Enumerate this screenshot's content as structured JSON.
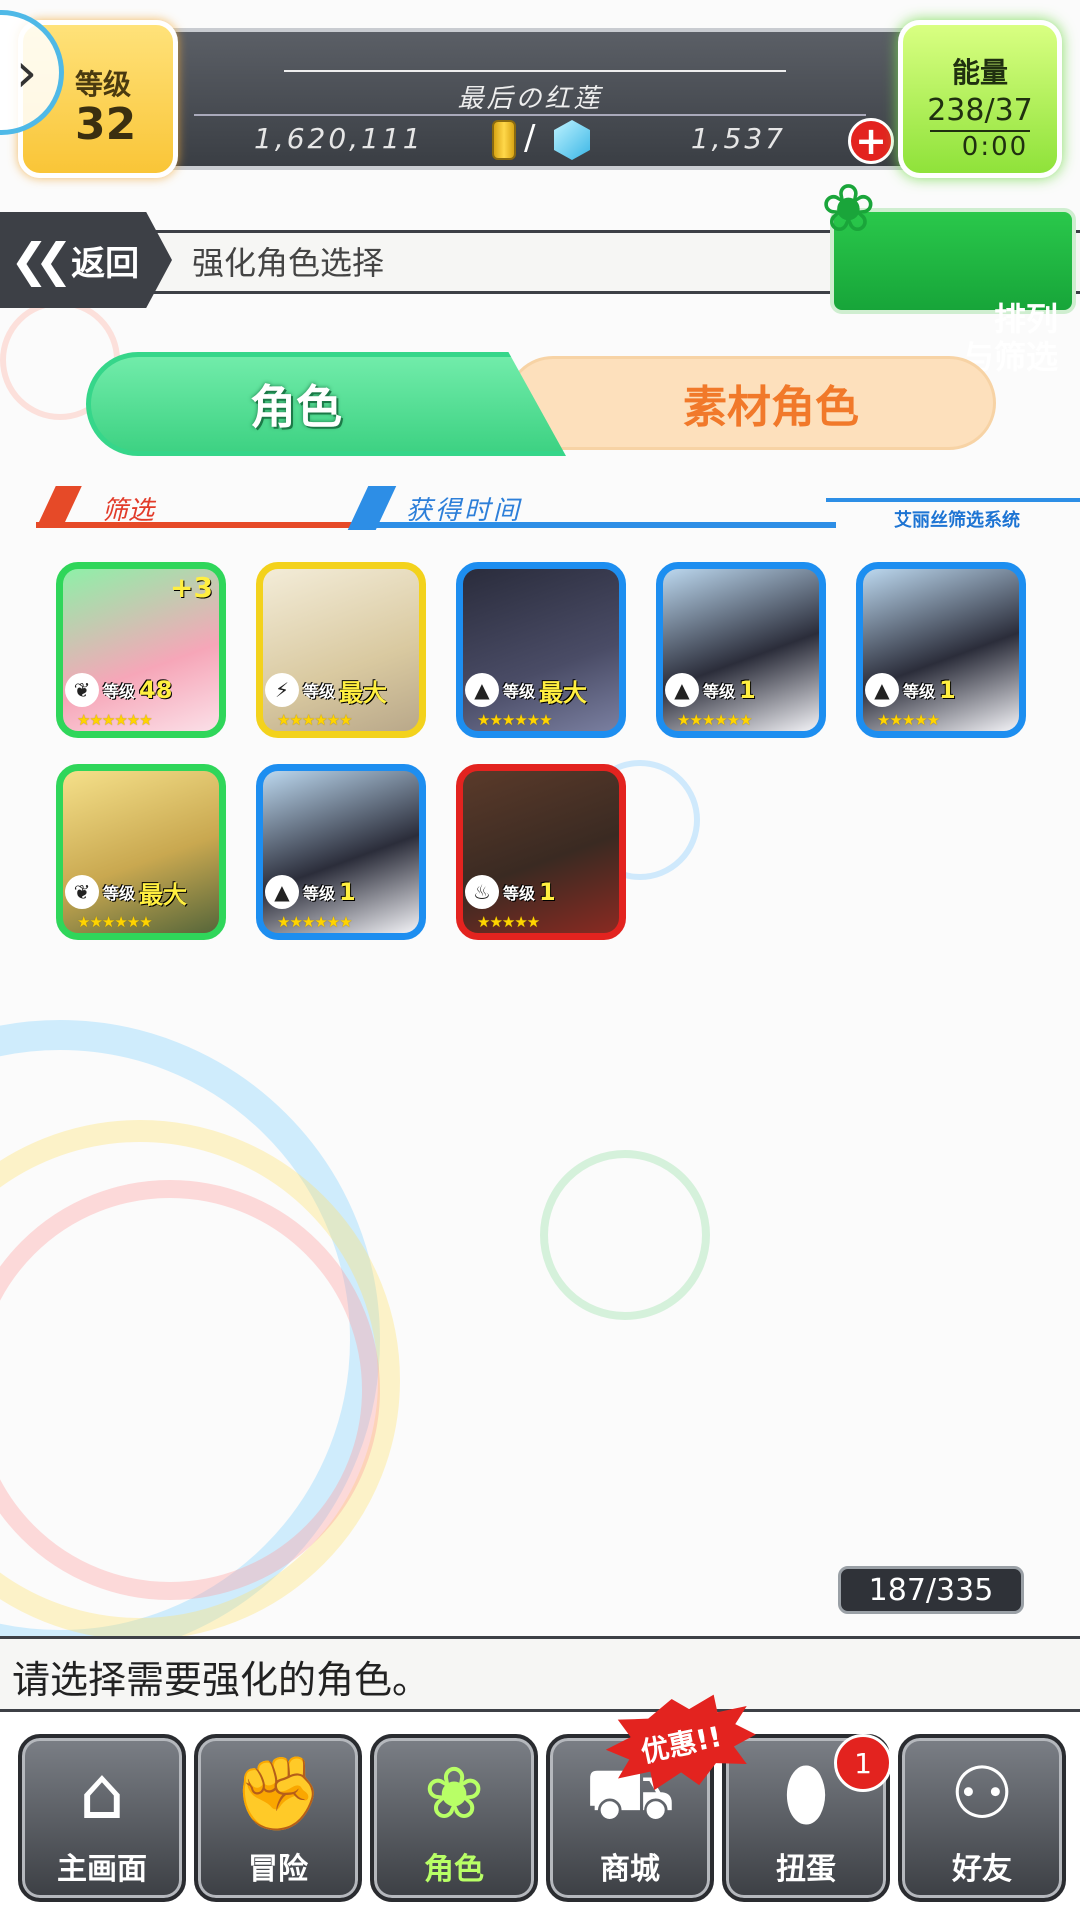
{
  "player": {
    "level_label": "等级",
    "level": "32",
    "name": "最后の红莲",
    "gold": "1,620,111",
    "gems": "1,537",
    "energy_label": "能量",
    "energy": "238/37",
    "energy_timer": "0:00"
  },
  "header": {
    "back_label": "返回",
    "title": "强化角色选择",
    "sort_filter_label": "排列\n与筛选"
  },
  "tabs": [
    {
      "label": "角色",
      "active": true
    },
    {
      "label": "素材角色",
      "active": false
    }
  ],
  "filters": {
    "filter_label": "筛选",
    "sort_label": "获得时间",
    "system_label": "艾丽丝筛选系统"
  },
  "characters": [
    {
      "level_label": "等级",
      "level": "48",
      "bonus": "+3",
      "element": "wind",
      "frame": "#2fd65a",
      "stars": "☆☆☆☆☆☆"
    },
    {
      "level_label": "等级",
      "level": "最大",
      "bonus": "",
      "element": "thunder",
      "frame": "#f3d21c",
      "stars": "☆☆☆☆☆☆"
    },
    {
      "level_label": "等级",
      "level": "最大",
      "bonus": "",
      "element": "water",
      "frame": "#1d8ef0",
      "stars": "☆☆☆☆☆☆"
    },
    {
      "level_label": "等级",
      "level": "1",
      "bonus": "",
      "element": "water",
      "frame": "#1d8ef0",
      "stars": "☆☆☆☆☆☆"
    },
    {
      "level_label": "等级",
      "level": "1",
      "bonus": "",
      "element": "water",
      "frame": "#1d8ef0",
      "stars": "☆☆☆☆☆"
    },
    {
      "level_label": "等级",
      "level": "最大",
      "bonus": "",
      "element": "wind",
      "frame": "#2fd65a",
      "stars": "☆☆☆☆☆☆"
    },
    {
      "level_label": "等级",
      "level": "1",
      "bonus": "",
      "element": "water",
      "frame": "#1d8ef0",
      "stars": "☆☆☆☆☆☆"
    },
    {
      "level_label": "等级",
      "level": "1",
      "bonus": "",
      "element": "fire",
      "frame": "#e3231f",
      "stars": "☆☆☆☆☆"
    }
  ],
  "counter": "187/335",
  "message": "请选择需要强化的角色。",
  "bottom_nav": [
    {
      "label": "主画面",
      "icon": "home-icon",
      "active": false
    },
    {
      "label": "冒险",
      "icon": "handshake-icon",
      "active": false
    },
    {
      "label": "角色",
      "icon": "bunny-icon",
      "active": true
    },
    {
      "label": "商城",
      "icon": "cart-icon",
      "active": false
    },
    {
      "label": "扭蛋",
      "icon": "egg-icon",
      "active": false
    },
    {
      "label": "好友",
      "icon": "friends-icon",
      "active": false
    }
  ],
  "deal_badge": "优惠!!",
  "gacha_notification": "1"
}
